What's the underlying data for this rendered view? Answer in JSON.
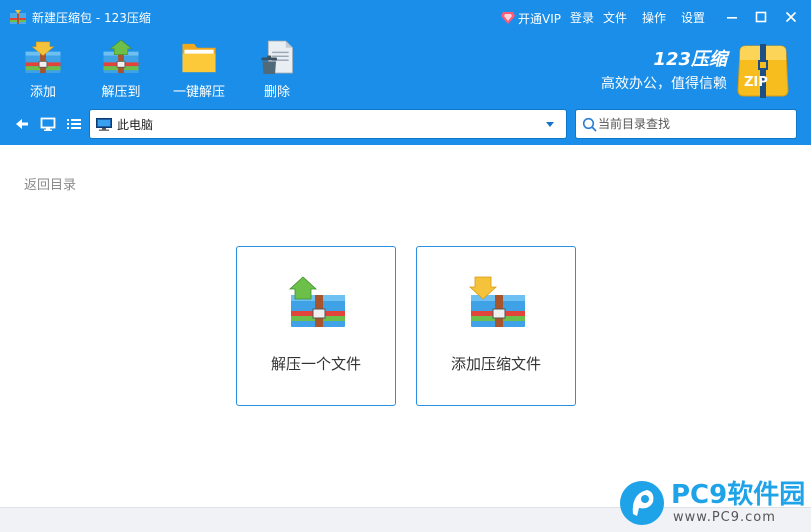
{
  "titlebar": {
    "title": "新建压缩包 - 123压缩",
    "vip_label": "开通VIP",
    "menu": [
      "登录",
      "文件",
      "操作",
      "设置"
    ]
  },
  "toolbar": {
    "add_label": "添加",
    "extract_to_label": "解压到",
    "one_click_label": "一键解压",
    "delete_label": "删除"
  },
  "brand": {
    "name": "123压缩",
    "slogan": "高效办公，值得信赖",
    "logo_text": "ZIP"
  },
  "nav": {
    "address": "此电脑",
    "search_placeholder": "当前目录查找"
  },
  "main": {
    "back_label": "返回目录",
    "cards": [
      "解压一个文件",
      "添加压缩文件"
    ]
  },
  "watermark": {
    "name": "PC9软件园",
    "url": "www.PC9.com"
  },
  "colors": {
    "header_bg": "#1a8ee8",
    "card_border": "#2a90e4",
    "vip_gem": "#ff5a78"
  }
}
